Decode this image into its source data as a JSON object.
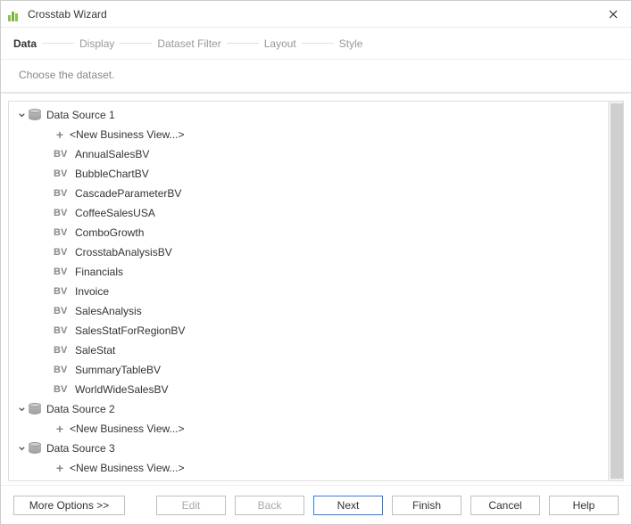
{
  "window": {
    "title": "Crosstab Wizard"
  },
  "steps": [
    "Data",
    "Display",
    "Dataset Filter",
    "Layout",
    "Style"
  ],
  "activeStepIndex": 0,
  "instruction": "Choose the dataset.",
  "tree": {
    "sources": [
      {
        "name": "Data Source 1",
        "newBusinessView": "<New Business View...>",
        "views": [
          "AnnualSalesBV",
          "BubbleChartBV",
          "CascadeParameterBV",
          "CoffeeSalesUSA",
          "ComboGrowth",
          "CrosstabAnalysisBV",
          "Financials",
          "Invoice",
          "SalesAnalysis",
          "SalesStatForRegionBV",
          "SaleStat",
          "SummaryTableBV",
          "WorldWideSalesBV"
        ]
      },
      {
        "name": "Data Source 2",
        "newBusinessView": "<New Business View...>",
        "views": []
      },
      {
        "name": "Data Source 3",
        "newBusinessView": "<New Business View...>",
        "views": []
      }
    ]
  },
  "buttons": {
    "moreOptions": "More Options >>",
    "edit": "Edit",
    "back": "Back",
    "next": "Next",
    "finish": "Finish",
    "cancel": "Cancel",
    "help": "Help"
  }
}
